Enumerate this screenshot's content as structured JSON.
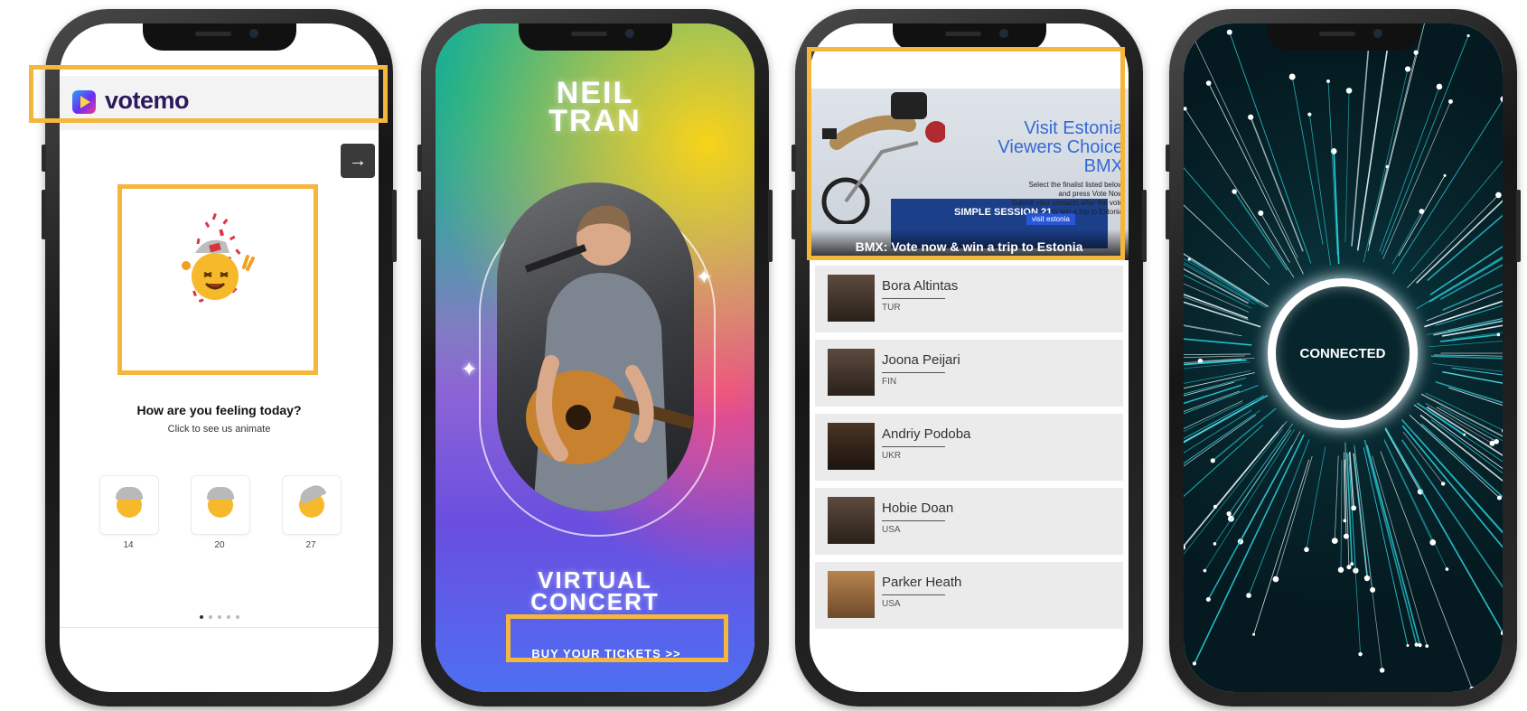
{
  "phone1": {
    "brand": "votemo",
    "next_icon": "→",
    "question": "How are you feeling today?",
    "subtitle": "Click to see us animate",
    "options": [
      {
        "count": "14"
      },
      {
        "count": "20"
      },
      {
        "count": "27"
      }
    ],
    "pagination_active": 1,
    "pagination_total": 5
  },
  "phone2": {
    "title_line1": "NEIL",
    "title_line2": "TRAN",
    "event_line1": "VIRTUAL",
    "event_line2": "CONCERT",
    "cta": "BUY YOUR TICKETS >>"
  },
  "phone3": {
    "banner_title_1": "Visit Estonia",
    "banner_title_2": "Viewers Choice",
    "banner_title_3": "BMX",
    "banner_text_1": "Select the finalist listed below",
    "banner_text_2": "and press Vote Now",
    "banner_text_3": "Submit your contacts after the vote",
    "banner_text_4": "to win a trip to Estonia",
    "sponsor_1": "SIMPLE SESSION 21",
    "sponsor_2": "visit estonia",
    "caption": "BMX: Vote now & win a trip to Estonia",
    "finalists": [
      {
        "name": "Bora Altintas",
        "country": "TUR"
      },
      {
        "name": "Joona Peijari",
        "country": "FIN"
      },
      {
        "name": "Andriy Podoba",
        "country": "UKR"
      },
      {
        "name": "Hobie Doan",
        "country": "USA"
      },
      {
        "name": "Parker Heath",
        "country": "USA"
      }
    ]
  },
  "phone4": {
    "status": "CONNECTED"
  },
  "colors": {
    "highlight": "#f4b63b",
    "votemo_brand": "#2a1b5c",
    "estonia_blue": "#3569d6",
    "network_teal": "#2ad4e0"
  }
}
